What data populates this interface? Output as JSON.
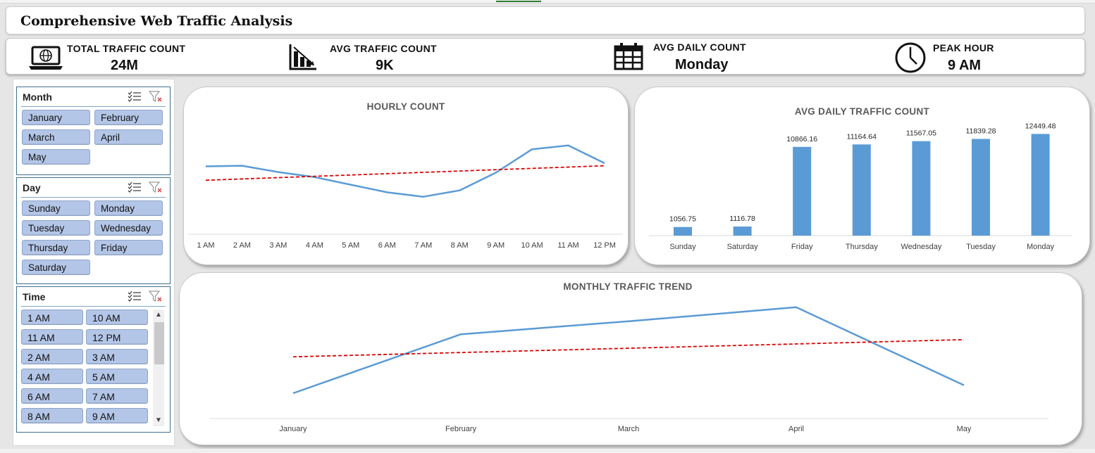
{
  "dashboard": {
    "title": "Comprehensive Web Traffic Analysis"
  },
  "kpis": [
    {
      "label": "TOTAL TRAFFIC COUNT",
      "value": "24M",
      "icon": "laptop-globe-icon"
    },
    {
      "label": "AVG TRAFFIC COUNT",
      "value": "9K",
      "icon": "bar-chart-icon"
    },
    {
      "label": "AVG DAILY COUNT",
      "value": "Monday",
      "icon": "calendar-icon"
    },
    {
      "label": "PEAK HOUR",
      "value": "9 AM",
      "icon": "clock-icon"
    }
  ],
  "slicers": {
    "month": {
      "title": "Month",
      "items": [
        "January",
        "February",
        "March",
        "April",
        "May"
      ]
    },
    "day": {
      "title": "Day",
      "items": [
        "Sunday",
        "Monday",
        "Tuesday",
        "Wednesday",
        "Thursday",
        "Friday",
        "Saturday"
      ]
    },
    "time": {
      "title": "Time",
      "items": [
        "1 AM",
        "10 AM",
        "11 AM",
        "12 PM",
        "2 AM",
        "3 AM",
        "4 AM",
        "5 AM",
        "6 AM",
        "7 AM",
        "8 AM",
        "9 AM"
      ]
    }
  },
  "colors": {
    "series": "#5b9bd5",
    "trend": "#e00000",
    "slicer_button": "#b4c6e7"
  },
  "chart_data": [
    {
      "type": "line",
      "title": "HOURLY COUNT",
      "categories": [
        "1 AM",
        "2 AM",
        "3 AM",
        "4 AM",
        "5 AM",
        "6 AM",
        "7 AM",
        "8 AM",
        "9 AM",
        "10 AM",
        "11 AM",
        "12 PM"
      ],
      "values": [
        0.55,
        0.56,
        0.46,
        0.38,
        0.26,
        0.14,
        0.07,
        0.17,
        0.45,
        0.82,
        0.88,
        0.6
      ],
      "trendline": "linear",
      "value_axis_visible": false,
      "grid": false
    },
    {
      "type": "bar",
      "title": "AVG DAILY TRAFFIC COUNT",
      "categories": [
        "Sunday",
        "Saturday",
        "Friday",
        "Thursday",
        "Wednesday",
        "Tuesday",
        "Monday"
      ],
      "values": [
        1056.75,
        1116.78,
        10866.16,
        11164.64,
        11567.05,
        11839.28,
        12449.48
      ],
      "ylim": [
        0,
        13000
      ],
      "value_axis_visible": false,
      "grid": false
    },
    {
      "type": "line",
      "title": "MONTHLY TRAFFIC TREND",
      "categories": [
        "January",
        "February",
        "March",
        "April",
        "May"
      ],
      "values": [
        0.12,
        0.71,
        0.84,
        0.98,
        0.2
      ],
      "trendline": "linear",
      "value_axis_visible": false,
      "grid": false
    }
  ]
}
